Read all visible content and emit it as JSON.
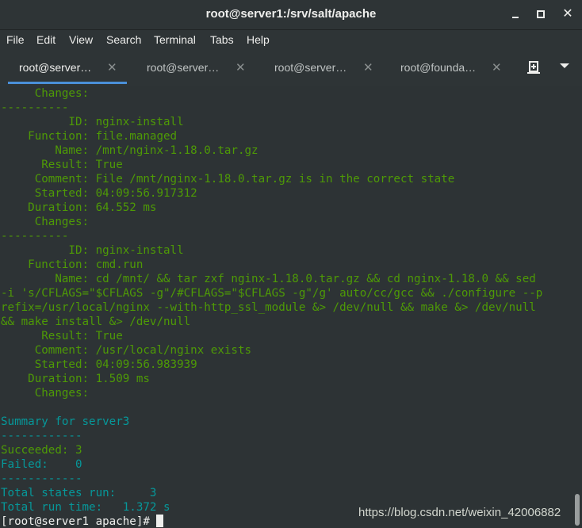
{
  "window": {
    "title": "root@server1:/srv/salt/apache"
  },
  "menu": [
    "File",
    "Edit",
    "View",
    "Search",
    "Terminal",
    "Tabs",
    "Help"
  ],
  "tabs": [
    {
      "label": "root@server…",
      "active": true
    },
    {
      "label": "root@server…",
      "active": false
    },
    {
      "label": "root@server…",
      "active": false
    },
    {
      "label": "root@founda…",
      "active": false
    }
  ],
  "terminal_lines": [
    {
      "text": "     Changes:",
      "color": "g"
    },
    {
      "text": "----------",
      "color": "g"
    },
    {
      "text": "          ID: nginx-install",
      "color": "g"
    },
    {
      "text": "    Function: file.managed",
      "color": "g"
    },
    {
      "text": "        Name: /mnt/nginx-1.18.0.tar.gz",
      "color": "g"
    },
    {
      "text": "      Result: True",
      "color": "g"
    },
    {
      "text": "     Comment: File /mnt/nginx-1.18.0.tar.gz is in the correct state",
      "color": "g"
    },
    {
      "text": "     Started: 04:09:56.917312",
      "color": "g"
    },
    {
      "text": "    Duration: 64.552 ms",
      "color": "g"
    },
    {
      "text": "     Changes:",
      "color": "g"
    },
    {
      "text": "----------",
      "color": "g"
    },
    {
      "text": "          ID: nginx-install",
      "color": "g"
    },
    {
      "text": "    Function: cmd.run",
      "color": "g"
    },
    {
      "text": "        Name: cd /mnt/ && tar zxf nginx-1.18.0.tar.gz && cd nginx-1.18.0 && sed",
      "color": "g"
    },
    {
      "text": "-i 's/CFLAGS=\"$CFLAGS -g\"/#CFLAGS=\"$CFLAGS -g\"/g' auto/cc/gcc && ./configure --p",
      "color": "g"
    },
    {
      "text": "refix=/usr/local/nginx --with-http_ssl_module &> /dev/null && make &> /dev/null",
      "color": "g"
    },
    {
      "text": "&& make install &> /dev/null",
      "color": "g"
    },
    {
      "text": "      Result: True",
      "color": "g"
    },
    {
      "text": "     Comment: /usr/local/nginx exists",
      "color": "g"
    },
    {
      "text": "     Started: 04:09:56.983939",
      "color": "g"
    },
    {
      "text": "    Duration: 1.509 ms",
      "color": "g"
    },
    {
      "text": "     Changes:",
      "color": "g"
    },
    {
      "text": "",
      "color": "g"
    },
    {
      "text": "Summary for server3",
      "color": "c"
    },
    {
      "text": "------------",
      "color": "c"
    },
    {
      "text": "Succeeded: 3",
      "color": "g"
    },
    {
      "text": "Failed:    0",
      "color": "c"
    },
    {
      "text": "------------",
      "color": "c"
    },
    {
      "text": "Total states run:     3",
      "color": "c"
    },
    {
      "text": "Total run time:   1.372 s",
      "color": "c"
    }
  ],
  "prompt": "[root@server1 apache]# ",
  "watermark": "https://blog.csdn.net/weixin_42006882",
  "colors": {
    "green": "#4e9a06",
    "cyan": "#06989a",
    "tab_accent": "#4a90d9",
    "background": "#2d3335"
  }
}
